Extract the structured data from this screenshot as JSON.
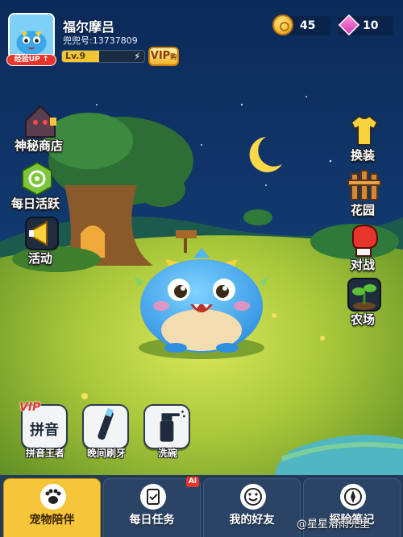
{
  "player": {
    "name": "福尔摩吕",
    "uid": "兜兜号:13737809",
    "exp_badge": "经验UP ↑",
    "level": "Lv.9",
    "level_progress": 0.45,
    "vip_label": "VIP",
    "vip_sub": "购"
  },
  "currency": {
    "coins": "45",
    "gems": "10"
  },
  "left_menu": [
    {
      "label": "神秘商店",
      "icon": "shop-hut-icon"
    },
    {
      "label": "每日活跃",
      "icon": "daily-active-icon"
    },
    {
      "label": "活动",
      "icon": "megaphone-icon"
    }
  ],
  "right_menu": [
    {
      "label": "换装",
      "icon": "shirt-icon"
    },
    {
      "label": "花园",
      "icon": "fence-icon"
    },
    {
      "label": "对战",
      "icon": "boxing-glove-icon"
    },
    {
      "label": "农场",
      "icon": "sprout-icon"
    }
  ],
  "actions": [
    {
      "label": "拼音王者",
      "card_text": "拼音",
      "tag": "VIP",
      "icon": "pinyin-icon"
    },
    {
      "label": "晚间刷牙",
      "icon": "toothbrush-icon"
    },
    {
      "label": "洗碗",
      "icon": "spray-bottle-icon"
    }
  ],
  "tabs": [
    {
      "label": "宠物陪伴",
      "icon": "paw-icon",
      "active": true
    },
    {
      "label": "每日任务",
      "icon": "checklist-icon",
      "active": false,
      "badge": "AI"
    },
    {
      "label": "我的好友",
      "icon": "smiley-icon",
      "active": false
    },
    {
      "label": "探险笔记",
      "icon": "compass-icon",
      "active": false
    }
  ],
  "watermark": "@星星溶雨兜里",
  "colors": {
    "active_tab": "#f6c53a",
    "tab_bg": "#2b4466",
    "level_fill": "#f4c635",
    "pet_body": "#4fb4f2",
    "grass": "#9cbf33"
  }
}
